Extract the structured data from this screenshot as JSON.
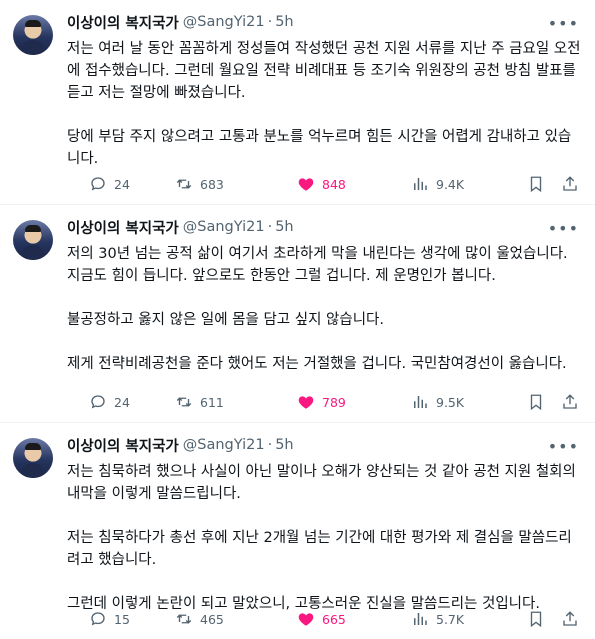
{
  "author": {
    "name": "이상이의 복지국가",
    "handle": "@SangYi21",
    "separator": "·"
  },
  "tweets": [
    {
      "time": "5h",
      "paragraphs": [
        "저는 여러 날 동안 꼼꼼하게 정성들여 작성했던 공천 지원 서류를 지난 주 금요일 오전에 접수했습니다. 그런데 월요일 전략 비례대표 등 조기숙 위원장의 공천 방침 발표를 듣고 저는 절망에 빠졌습니다.",
        "당에 부담 주지 않으려고 고통과 분노를 억누르며 힘든 시간을 어렵게 감내하고 있습니다."
      ],
      "replies": "24",
      "retweets": "683",
      "likes": "848",
      "views": "9.4K"
    },
    {
      "time": "5h",
      "paragraphs": [
        "저의 30년 넘는 공적 삶이 여기서 초라하게 막을 내린다는 생각에 많이 울었습니다. 지금도 힘이 듭니다. 앞으로도 한동안 그럴 겁니다. 제 운명인가 봅니다.",
        "불공정하고 옳지 않은 일에 몸을 담고 싶지 않습니다.",
        "제게 전략비례공천을 준다 했어도 저는 거절했을 겁니다. 국민참여경선이 옳습니다."
      ],
      "replies": "24",
      "retweets": "611",
      "likes": "789",
      "views": "9.5K"
    },
    {
      "time": "5h",
      "paragraphs": [
        "저는 침묵하려 했으나 사실이 아닌 말이나 오해가 양산되는 것 같아 공천 지원 철회의 내막을 이렇게 말씀드립니다.",
        "저는 침묵하다가 총선 후에 지난 2개월 넘는 기간에 대한 평가와 제 결심을 말씀드리려고 했습니다.",
        "그런데 이렇게 논란이 되고 말았으니, 고통스러운 진실을 말씀드리는 것입니다."
      ],
      "replies": "15",
      "retweets": "465",
      "likes": "665",
      "views": "5.7K"
    }
  ],
  "icons": {
    "reply": "reply-icon",
    "retweet": "retweet-icon",
    "like": "heart-filled-icon",
    "views": "views-chart-icon",
    "bookmark": "bookmark-icon",
    "share": "share-icon",
    "more": "more-dots-icon"
  },
  "colors": {
    "like_active": "#f91880",
    "secondary_text": "#536471",
    "primary_text": "#0f1419"
  },
  "more_glyph": "•••"
}
